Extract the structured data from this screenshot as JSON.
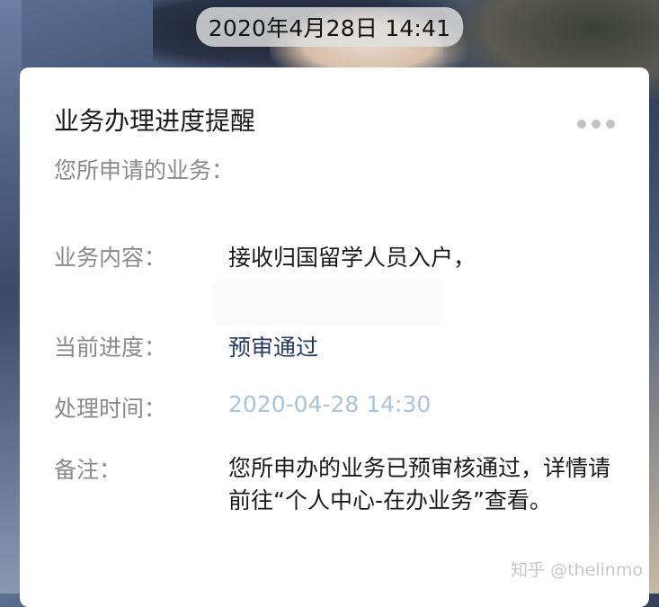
{
  "status_time": "2020年4月28日 14:41",
  "card": {
    "title": "业务办理进度提醒",
    "subtitle": "您所申请的业务：",
    "rows": [
      {
        "label": "业务内容：",
        "value": "接收归国留学人员入户，"
      },
      {
        "label": "当前进度：",
        "value": "预审通过"
      },
      {
        "label": "处理时间：",
        "value": "2020-04-28 14:30"
      },
      {
        "label": "备注：",
        "value": "您所申办的业务已预审核通过，详情请前往“个人中心-在办业务”查看。"
      }
    ]
  },
  "watermark": "知乎 @thelinmo",
  "icons": {
    "more": "more-dots-icon"
  },
  "colors": {
    "progress_value": "#27396b",
    "time_value": "#a9c3dc",
    "label_gray": "#8a8a8a"
  }
}
